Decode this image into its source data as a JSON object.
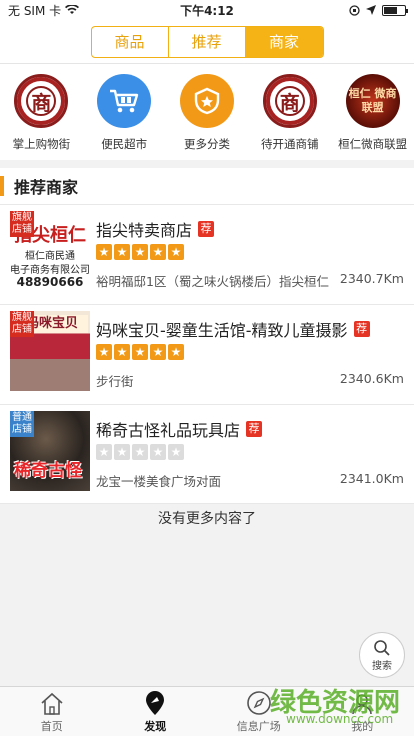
{
  "status_bar": {
    "carrier": "无 SIM 卡",
    "time": "下午4:12",
    "battery_level": 0.65
  },
  "segments": {
    "items": [
      "商品",
      "推荐",
      "商家"
    ],
    "active_index": 2
  },
  "categories": [
    {
      "label": "掌上购物街",
      "icon": "shang-logo-icon",
      "glyph": "商"
    },
    {
      "label": "便民超市",
      "icon": "shopping-cart-icon"
    },
    {
      "label": "更多分类",
      "icon": "shield-star-icon"
    },
    {
      "label": "待开通商铺",
      "icon": "shang-logo-icon",
      "glyph": "商"
    },
    {
      "label": "桓仁微商联盟",
      "icon": "alliance-logo-icon",
      "glyph": "桓仁 微商联盟"
    }
  ],
  "section": {
    "title": "推荐商家"
  },
  "stores": [
    {
      "tag": "旗舰 店铺",
      "tag_color": "#d62b1f",
      "thumb_title": "指尖桓仁",
      "thumb_sub1": "桓仁商民通",
      "thumb_sub2": "电子商务有限公司",
      "thumb_phone": "48890666",
      "name": "指尖特卖商店",
      "badge": "荐",
      "rating": 5,
      "address": "裕明福邸1区（蜀之味火锅楼后）指尖桓仁",
      "distance": "2340.7Km"
    },
    {
      "tag": "旗舰 店铺",
      "tag_color": "#d62b1f",
      "thumb_title": "妈咪宝贝",
      "name": "妈咪宝贝-婴童生活馆-精致儿童摄影",
      "badge": "荐",
      "rating": 5,
      "address": "步行街",
      "distance": "2340.6Km"
    },
    {
      "tag": "普通 店铺",
      "tag_color": "#3a82c9",
      "thumb_title": "稀奇古怪",
      "name": "稀奇古怪礼品玩具店",
      "badge": "荐",
      "rating": 0,
      "address": "龙宝一楼美食广场对面",
      "distance": "2341.0Km"
    }
  ],
  "no_more": "没有更多内容了",
  "search_fab": {
    "label": "搜索"
  },
  "tabbar": {
    "items": [
      "首页",
      "发现",
      "信息广场",
      "我的"
    ],
    "active_index": 1
  },
  "watermark": {
    "text": "绿色资源网",
    "url": "www.downcc.com"
  }
}
